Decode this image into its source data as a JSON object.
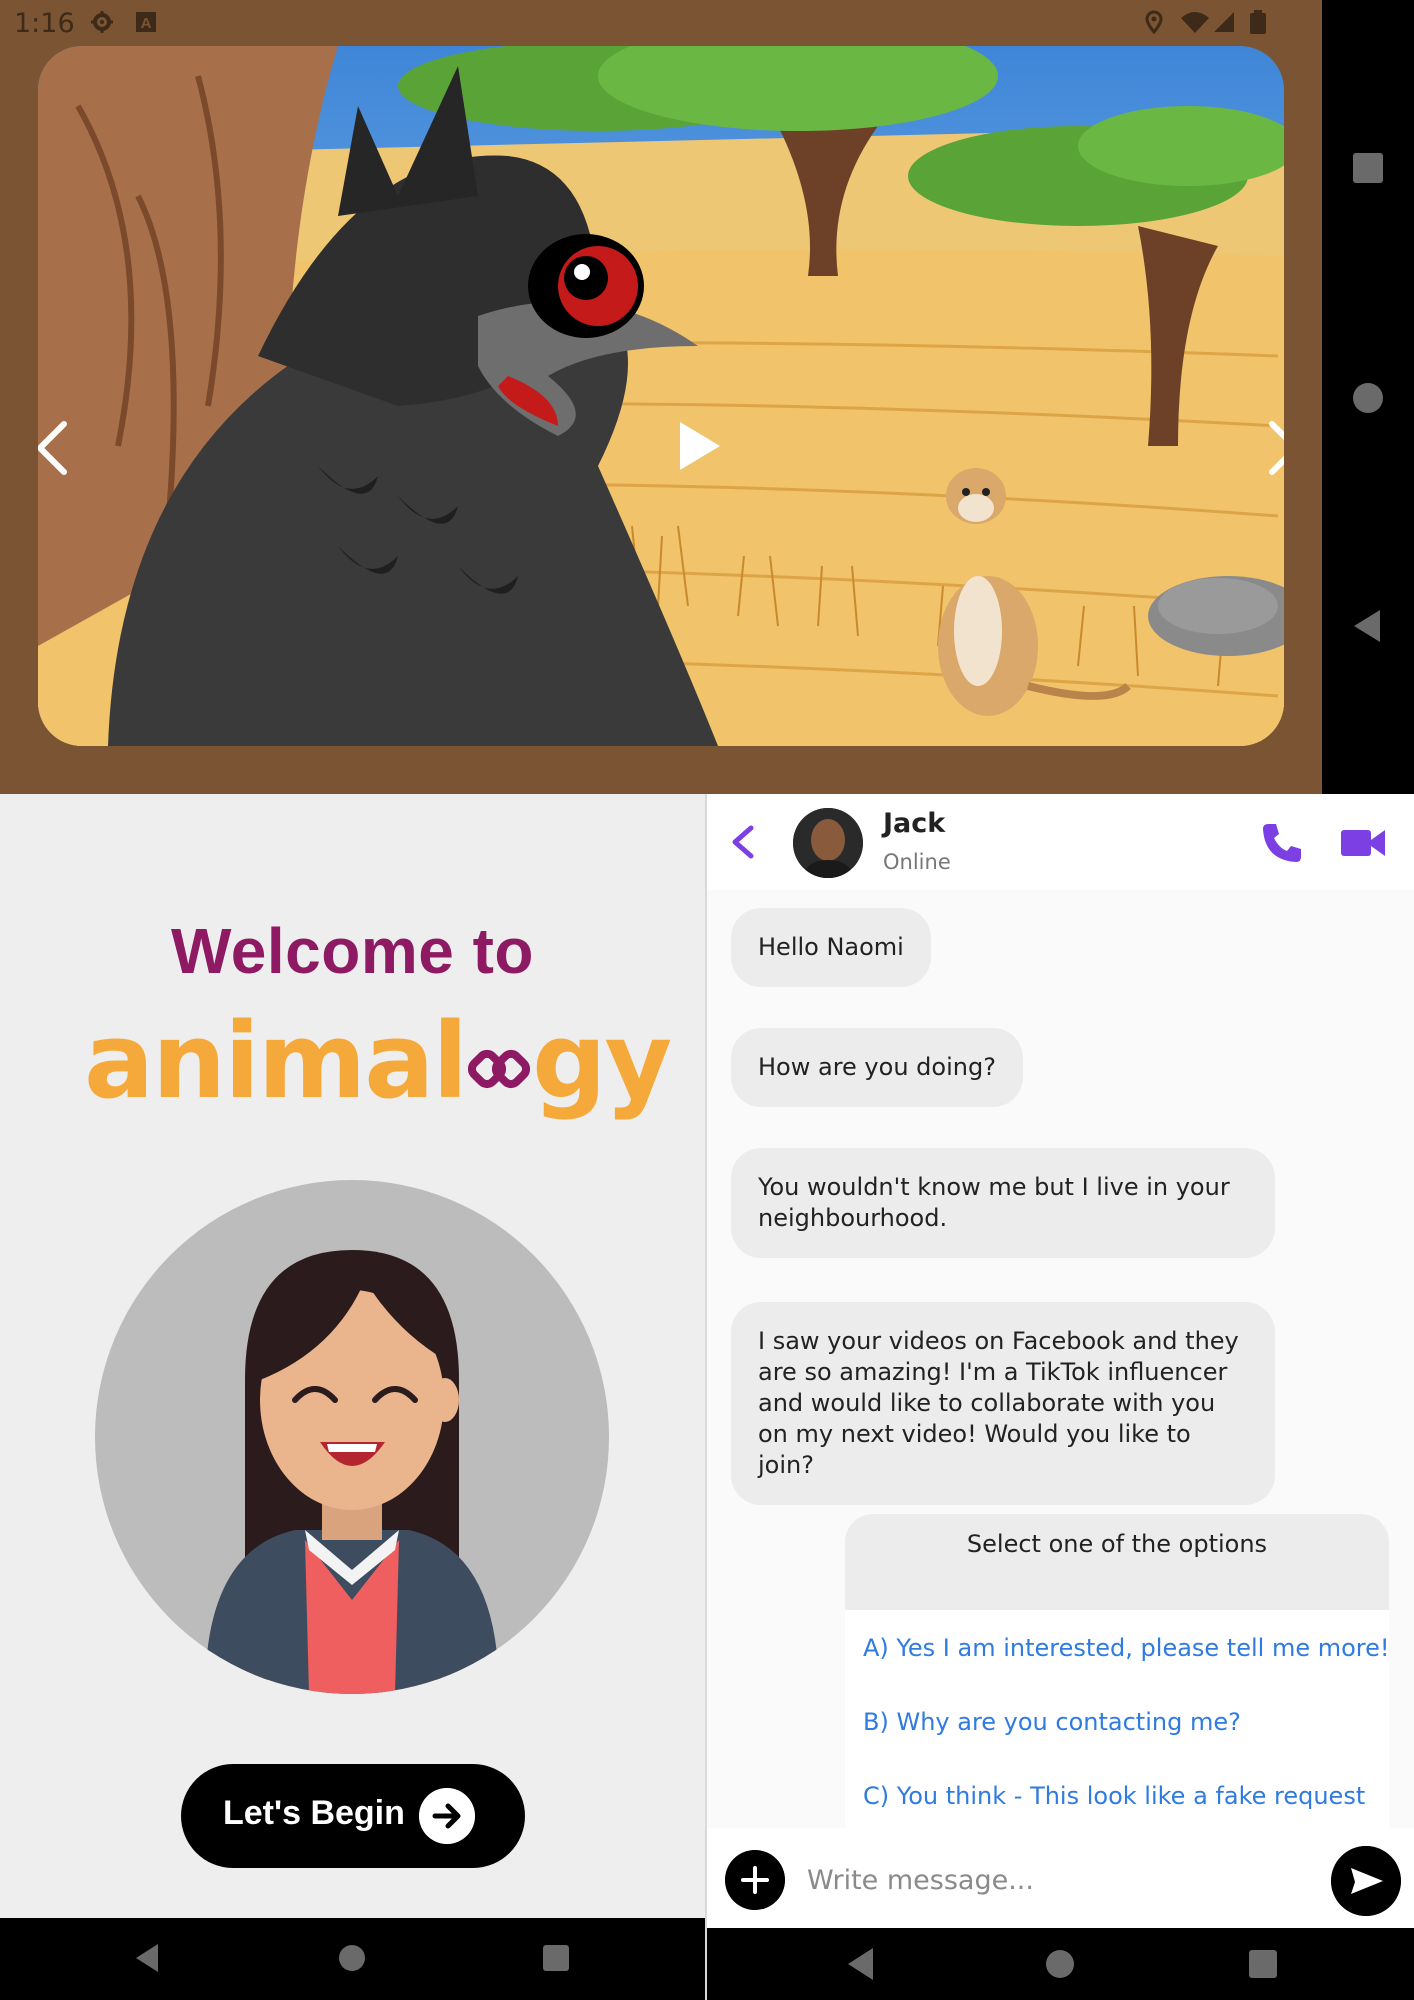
{
  "status_bar": {
    "time": "1:16",
    "icons": [
      "gear-icon",
      "a-icon",
      "location-icon",
      "wifi-icon",
      "signal-icon",
      "battery-icon"
    ]
  },
  "video": {
    "scene": "savanna-cartoon",
    "controls": {
      "prev_icon": "chevron-left-icon",
      "play_icon": "play-icon",
      "next_icon": "chevron-right-icon"
    }
  },
  "system_nav_right": [
    "square-icon",
    "circle-icon",
    "triangle-back-icon"
  ],
  "welcome": {
    "title": "Welcome to",
    "brand_start": "animal",
    "brand_end": "gy",
    "begin_label": "Let's Begin",
    "begin_icon": "arrow-right-icon"
  },
  "chat": {
    "contact": {
      "name": "Jack",
      "status": "Online"
    },
    "messages": [
      "Hello Naomi",
      "How are you doing?",
      "You wouldn't know me but I live in your neighbourhood.",
      "I saw your videos on Facebook and they are so amazing! I'm a TikTok influencer and would like to collaborate with you on my next video! Would you like to join?"
    ],
    "options": {
      "title": "Select one of the options",
      "items": [
        "A) Yes I am interested, please tell me more!",
        "B) Why are you contacting me?",
        "C) You think - This look like a fake request"
      ]
    },
    "composer": {
      "placeholder": "Write message..."
    }
  },
  "colors": {
    "accent": "#7b3fe4",
    "title": "#8e1a63",
    "brand": "#f6a93b",
    "option_link": "#2f7be0",
    "frame": "#7b5533"
  }
}
